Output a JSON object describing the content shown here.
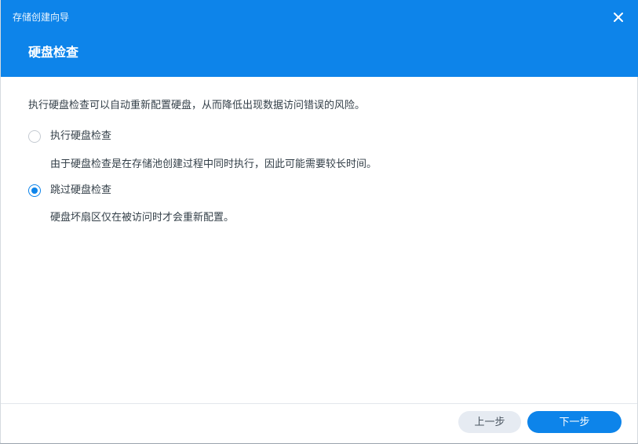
{
  "window": {
    "title": "存储创建向导",
    "close_icon": "close-icon"
  },
  "page": {
    "title": "硬盘检查",
    "intro": "执行硬盘检查可以自动重新配置硬盘，从而降低出现数据访问错误的风险。"
  },
  "options": [
    {
      "label": "执行硬盘检查",
      "description": "由于硬盘检查是在存储池创建过程中同时执行，因此可能需要较长时间。",
      "selected": false
    },
    {
      "label": "跳过硬盘检查",
      "description": "硬盘坏扇区仅在被访问时才会重新配置。",
      "selected": true
    }
  ],
  "footer": {
    "prev_label": "上一步",
    "next_label": "下一步"
  },
  "colors": {
    "accent": "#0d84ea",
    "text": "#333f48",
    "secondary_button": "#e6ebf2"
  }
}
